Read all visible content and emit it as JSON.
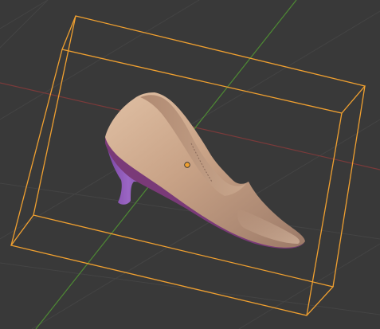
{
  "viewport": {
    "mode": "3d-viewport",
    "background_color": "#393939",
    "grid_color": "#444444",
    "x_axis_color": "#7a3a3a",
    "y_axis_color": "#4e8a34",
    "selection_outline_color": "#f0a030"
  },
  "scene": {
    "selected_object": {
      "kind": "shoe-mesh",
      "upper_color": "#c39e84",
      "sole_color": "#8e4fa8",
      "heel_color": "#8c54b8",
      "origin_point_color": "#f0a030"
    }
  }
}
